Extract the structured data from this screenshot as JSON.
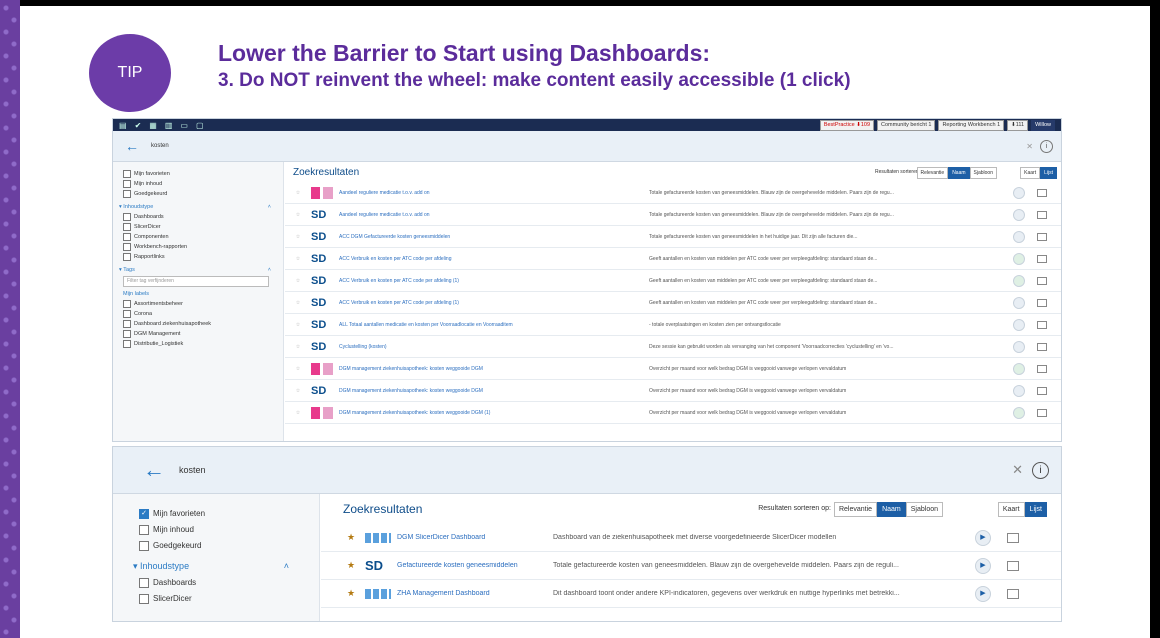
{
  "slide": {
    "tip": "TIP",
    "title": "Lower the Barrier to Start using Dashboards:",
    "subtitle": "3. Do NOT reinvent the wheel: make content easily accessible (1 click)"
  },
  "shot1": {
    "tabs": [
      "BestPractice ⬇109",
      "Community bericht 1",
      "Reporting Workbench 1",
      "⬇111",
      "Willow"
    ],
    "query": "kosten",
    "filters_top": [
      "Mijn favorieten",
      "Mijn inhoud",
      "Goedgekeurd"
    ],
    "section_type": "Inhoudstype",
    "types": [
      "Dashboards",
      "SlicerDicer",
      "Componenten",
      "Workbench-rapporten",
      "Rapportlinks"
    ],
    "section_tags": "Tags",
    "tag_filter_placeholder": "Filter tag verfijnderen",
    "my_labels": "Mijn labels",
    "labels": [
      "Assortimentsbeheer",
      "Corona",
      "Dashboard ziekenhuisapotheek",
      "DGM Management",
      "Distributie_Logistiek"
    ],
    "results_title": "Zoekresultaten",
    "sort_label": "Resultaten sorteren op:",
    "sort_options": [
      "Relevantie",
      "Naam",
      "Sjabloon"
    ],
    "view_options": [
      "Kaart",
      "Lijst"
    ],
    "rows": [
      {
        "name": "Aandeel reguliere medicatie t.o.v. add on",
        "desc": "Totale gefactureerde kosten van geneesmiddelen. Blauw zijn de overgeheveIde middelen. Paars zijn de regu..."
      },
      {
        "name": "Aandeel reguliere medicatie t.o.v. add on",
        "desc": "Totale gefactureerde kosten van geneesmiddelen. Blauw zijn de overgeheveIde middelen. Paars zijn de regu..."
      },
      {
        "name": "ACC DGM Gefactureerde kosten geneesmiddelen",
        "desc": "Totale gefactureerde kosten van geneesmiddelen in het huidige jaar. Dit zijn alle facturen die..."
      },
      {
        "name": "ACC Verbruik en kosten per ATC code per afdeling",
        "desc": "Geeft aantallen en kosten van middelen per ATC code weer per verpleegafdeling: standaard staan de..."
      },
      {
        "name": "ACC Verbruik en kosten per ATC code per afdeling (1)",
        "desc": "Geeft aantallen en kosten van middelen per ATC code weer per verpleegafdeling: standaard staan de..."
      },
      {
        "name": "ACC Verbruik en kosten per ATC code per afdeling (1)",
        "desc": "Geeft aantallen en kosten van middelen per ATC code weer per verpleegafdeling: standaard staan de..."
      },
      {
        "name": "ALL Totaal aantallen medicatie en kosten per Voorraadlocatie en Voorraaditem",
        "desc": "- totale overplaatsingen en kosten zien per ontvangstlocatie"
      },
      {
        "name": "Cyclustelling (kosten)",
        "desc": "Deze sessie kan gebruikt worden als vervanging van het component 'Voorraadcorrecties 'cyclustelling' en 'vo..."
      },
      {
        "name": "DGM management ziekenhuisapotheek: kosten weggooide DGM",
        "desc": "Overzicht per maand voor welk bedrag DGM is weggooid vanwege verlopen vervaldatum"
      },
      {
        "name": "DGM management ziekenhuisapotheek: kosten weggooide DGM",
        "desc": "Overzicht per maand voor welk bedrag DGM is weggooid vanwege verlopen vervaldatum"
      },
      {
        "name": "DGM management ziekenhuisapotheek: kosten weggooide DGM (1)",
        "desc": "Overzicht per maand voor welk bedrag DGM is weggooid vanwege verlopen vervaldatum"
      }
    ]
  },
  "shot2": {
    "query": "kosten",
    "filters_top": [
      "Mijn favorieten",
      "Mijn inhoud",
      "Goedgekeurd"
    ],
    "section_type": "Inhoudstype",
    "types": [
      "Dashboards",
      "SlicerDicer"
    ],
    "results_title": "Zoekresultaten",
    "sort_label": "Resultaten sorteren op:",
    "sort_options": [
      "Relevantie",
      "Naam",
      "Sjabloon"
    ],
    "view_options": [
      "Kaart",
      "Lijst"
    ],
    "rows": [
      {
        "name": "DGM SlicerDicer Dashboard",
        "desc": "Dashboard van de ziekenhuisapotheek met diverse voorgedefinieerde SlicerDicer modellen"
      },
      {
        "name": "Gefactureerde kosten geneesmiddelen",
        "desc": "Totale gefactureerde kosten van geneesmiddelen. Blauw zijn de overgeheveIde middelen. Paars zijn de reguli..."
      },
      {
        "name": "ZHA Management Dashboard",
        "desc": "Dit dashboard toont onder andere KPI-indicatoren, gegevens over werkdruk en nuttige hyperlinks met betrekki..."
      }
    ]
  }
}
